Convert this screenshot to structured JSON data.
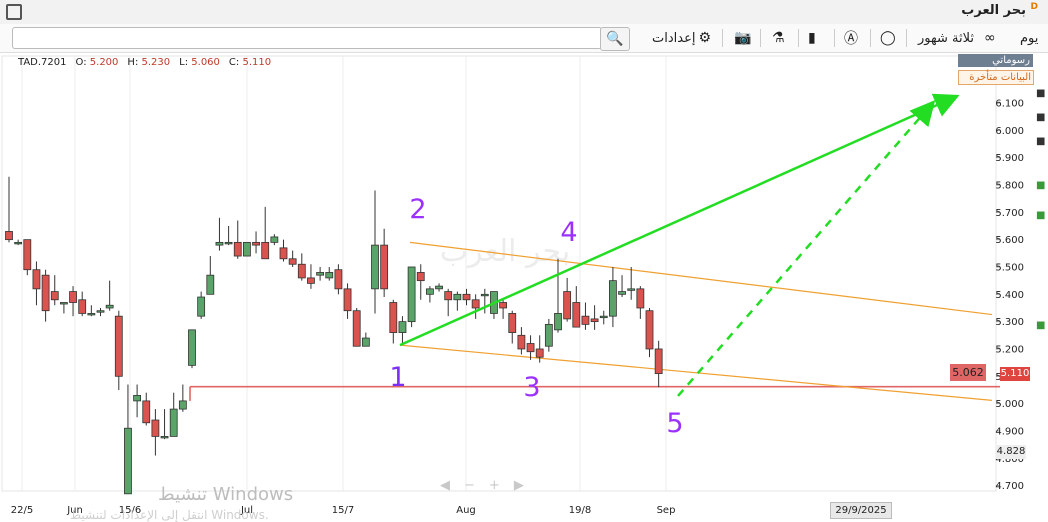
{
  "app": {
    "title": "بحر العرب",
    "badge": "D"
  },
  "toolbar": {
    "period": "يوم",
    "range": "ثلاثة شهور",
    "settings": "إعدادات",
    "search_placeholder": ""
  },
  "tags": {
    "drawings": "رسوماتي",
    "delayed": "البيانات متأخرة"
  },
  "ohlc": {
    "symbol": "TAD.7201",
    "o_label": "O:",
    "o": "5.200",
    "h_label": "H:",
    "h": "5.230",
    "l_label": "L:",
    "l": "5.060",
    "c_label": "C:",
    "c": "5.110"
  },
  "watermark": {
    "line1": "تنشيط Windows",
    "line2": "انتقل إلى الإعدادات لتنشيط Windows."
  },
  "labels": {
    "p1": "1",
    "p2": "2",
    "p3": "3",
    "p4": "4",
    "p5": "5"
  },
  "price_tags": {
    "line": "5.062",
    "last": "5.110",
    "cross": "4.828"
  },
  "date_tag": "29/9/2025",
  "chart_data": {
    "type": "candlestick",
    "x_tick_labels": [
      "22/5",
      "Jun",
      "15/6",
      "Jul",
      "15/7",
      "Aug",
      "19/8",
      "Sep"
    ],
    "y_tick_labels": [
      "4.700",
      "4.800",
      "4.900",
      "5.000",
      "5.100",
      "5.200",
      "5.300",
      "5.400",
      "5.500",
      "5.600",
      "5.700",
      "5.800",
      "5.900",
      "6.000",
      "6.100"
    ],
    "ylim": [
      4.67,
      6.2
    ],
    "candles": [
      {
        "o": 5.63,
        "h": 5.83,
        "l": 5.59,
        "c": 5.6
      },
      {
        "o": 5.59,
        "h": 5.6,
        "l": 5.58,
        "c": 5.59
      },
      {
        "o": 5.6,
        "h": 5.6,
        "l": 5.47,
        "c": 5.49
      },
      {
        "o": 5.49,
        "h": 5.52,
        "l": 5.36,
        "c": 5.42
      },
      {
        "o": 5.47,
        "h": 5.49,
        "l": 5.3,
        "c": 5.34
      },
      {
        "o": 5.41,
        "h": 5.47,
        "l": 5.36,
        "c": 5.38
      },
      {
        "o": 5.37,
        "h": 5.37,
        "l": 5.33,
        "c": 5.37
      },
      {
        "o": 5.41,
        "h": 5.43,
        "l": 5.32,
        "c": 5.37
      },
      {
        "o": 5.38,
        "h": 5.41,
        "l": 5.32,
        "c": 5.33
      },
      {
        "o": 5.33,
        "h": 5.36,
        "l": 5.32,
        "c": 5.33
      },
      {
        "o": 5.34,
        "h": 5.35,
        "l": 5.32,
        "c": 5.34
      },
      {
        "o": 5.35,
        "h": 5.45,
        "l": 5.34,
        "c": 5.36
      },
      {
        "o": 5.32,
        "h": 5.34,
        "l": 5.05,
        "c": 5.1
      },
      {
        "o": 4.67,
        "h": 5.07,
        "l": 4.67,
        "c": 4.91
      },
      {
        "o": 5.01,
        "h": 5.07,
        "l": 4.95,
        "c": 5.03
      },
      {
        "o": 5.01,
        "h": 5.04,
        "l": 4.92,
        "c": 4.93
      },
      {
        "o": 4.94,
        "h": 4.98,
        "l": 4.81,
        "c": 4.88
      },
      {
        "o": 4.88,
        "h": 4.98,
        "l": 4.87,
        "c": 4.88
      },
      {
        "o": 4.88,
        "h": 5.04,
        "l": 4.88,
        "c": 4.98
      },
      {
        "o": 4.98,
        "h": 5.07,
        "l": 4.97,
        "c": 5.01
      },
      {
        "o": 5.14,
        "h": 5.27,
        "l": 5.13,
        "c": 5.27
      },
      {
        "o": 5.32,
        "h": 5.41,
        "l": 5.31,
        "c": 5.39
      },
      {
        "o": 5.4,
        "h": 5.54,
        "l": 5.4,
        "c": 5.47
      },
      {
        "o": 5.58,
        "h": 5.68,
        "l": 5.56,
        "c": 5.59
      },
      {
        "o": 5.59,
        "h": 5.65,
        "l": 5.58,
        "c": 5.59
      },
      {
        "o": 5.59,
        "h": 5.67,
        "l": 5.53,
        "c": 5.54
      },
      {
        "o": 5.54,
        "h": 5.59,
        "l": 5.54,
        "c": 5.59
      },
      {
        "o": 5.59,
        "h": 5.63,
        "l": 5.55,
        "c": 5.58
      },
      {
        "o": 5.59,
        "h": 5.72,
        "l": 5.53,
        "c": 5.53
      },
      {
        "o": 5.59,
        "h": 5.62,
        "l": 5.58,
        "c": 5.61
      },
      {
        "o": 5.57,
        "h": 5.6,
        "l": 5.52,
        "c": 5.53
      },
      {
        "o": 5.53,
        "h": 5.56,
        "l": 5.5,
        "c": 5.51
      },
      {
        "o": 5.51,
        "h": 5.55,
        "l": 5.45,
        "c": 5.46
      },
      {
        "o": 5.46,
        "h": 5.51,
        "l": 5.42,
        "c": 5.44
      },
      {
        "o": 5.47,
        "h": 5.5,
        "l": 5.45,
        "c": 5.48
      },
      {
        "o": 5.46,
        "h": 5.5,
        "l": 5.45,
        "c": 5.48
      },
      {
        "o": 5.49,
        "h": 5.51,
        "l": 5.4,
        "c": 5.42
      },
      {
        "o": 5.42,
        "h": 5.44,
        "l": 5.31,
        "c": 5.34
      },
      {
        "o": 5.34,
        "h": 5.35,
        "l": 5.21,
        "c": 5.21
      },
      {
        "o": 5.21,
        "h": 5.26,
        "l": 5.21,
        "c": 5.24
      },
      {
        "o": 5.42,
        "h": 5.78,
        "l": 5.33,
        "c": 5.58
      },
      {
        "o": 5.58,
        "h": 5.64,
        "l": 5.39,
        "c": 5.42
      },
      {
        "o": 5.37,
        "h": 5.38,
        "l": 5.22,
        "c": 5.26
      },
      {
        "o": 5.26,
        "h": 5.32,
        "l": 5.22,
        "c": 5.3
      },
      {
        "o": 5.3,
        "h": 5.5,
        "l": 5.28,
        "c": 5.5
      },
      {
        "o": 5.48,
        "h": 5.51,
        "l": 5.38,
        "c": 5.45
      },
      {
        "o": 5.4,
        "h": 5.43,
        "l": 5.37,
        "c": 5.42
      },
      {
        "o": 5.42,
        "h": 5.44,
        "l": 5.41,
        "c": 5.43
      },
      {
        "o": 5.41,
        "h": 5.42,
        "l": 5.32,
        "c": 5.38
      },
      {
        "o": 5.38,
        "h": 5.41,
        "l": 5.34,
        "c": 5.4
      },
      {
        "o": 5.4,
        "h": 5.42,
        "l": 5.36,
        "c": 5.38
      },
      {
        "o": 5.38,
        "h": 5.4,
        "l": 5.31,
        "c": 5.35
      },
      {
        "o": 5.4,
        "h": 5.42,
        "l": 5.33,
        "c": 5.4
      },
      {
        "o": 5.33,
        "h": 5.41,
        "l": 5.31,
        "c": 5.41
      },
      {
        "o": 5.37,
        "h": 5.38,
        "l": 5.31,
        "c": 5.35
      },
      {
        "o": 5.33,
        "h": 5.34,
        "l": 5.22,
        "c": 5.26
      },
      {
        "o": 5.25,
        "h": 5.28,
        "l": 5.18,
        "c": 5.2
      },
      {
        "o": 5.22,
        "h": 5.25,
        "l": 5.16,
        "c": 5.19
      },
      {
        "o": 5.2,
        "h": 5.25,
        "l": 5.15,
        "c": 5.17
      },
      {
        "o": 5.21,
        "h": 5.31,
        "l": 5.19,
        "c": 5.29
      },
      {
        "o": 5.27,
        "h": 5.53,
        "l": 5.26,
        "c": 5.33
      },
      {
        "o": 5.41,
        "h": 5.46,
        "l": 5.3,
        "c": 5.31
      },
      {
        "o": 5.37,
        "h": 5.43,
        "l": 5.28,
        "c": 5.28
      },
      {
        "o": 5.32,
        "h": 5.37,
        "l": 5.27,
        "c": 5.29
      },
      {
        "o": 5.31,
        "h": 5.36,
        "l": 5.27,
        "c": 5.3
      },
      {
        "o": 5.32,
        "h": 5.34,
        "l": 5.29,
        "c": 5.32
      },
      {
        "o": 5.32,
        "h": 5.5,
        "l": 5.28,
        "c": 5.45
      },
      {
        "o": 5.4,
        "h": 5.47,
        "l": 5.39,
        "c": 5.41
      },
      {
        "o": 5.42,
        "h": 5.5,
        "l": 5.38,
        "c": 5.42
      },
      {
        "o": 5.42,
        "h": 5.43,
        "l": 5.31,
        "c": 5.35
      },
      {
        "o": 5.34,
        "h": 5.35,
        "l": 5.17,
        "c": 5.2
      },
      {
        "o": 5.2,
        "h": 5.23,
        "l": 5.06,
        "c": 5.11
      }
    ]
  }
}
